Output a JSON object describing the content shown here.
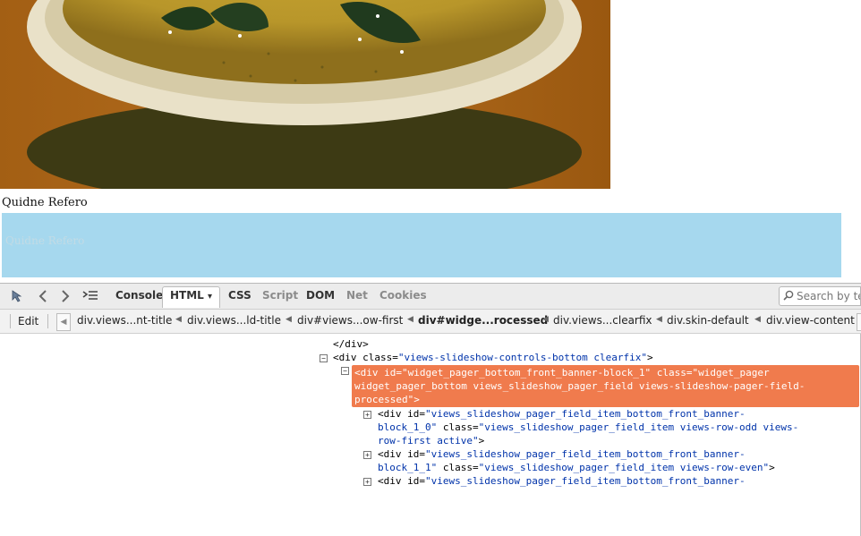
{
  "page": {
    "caption": "Quidne Refero",
    "banner_text": "Quidne Refero"
  },
  "toolbar": {
    "icons": [
      "inspect-icon",
      "back-icon",
      "forward-icon",
      "command-line-icon"
    ],
    "tabs": [
      {
        "label": "Console",
        "state": "normal"
      },
      {
        "label": "HTML",
        "state": "active"
      },
      {
        "label": "CSS",
        "state": "normal"
      },
      {
        "label": "Script",
        "state": "dim"
      },
      {
        "label": "DOM",
        "state": "normal"
      },
      {
        "label": "Net",
        "state": "dim"
      },
      {
        "label": "Cookies",
        "state": "dim"
      }
    ],
    "html_dropdown": "▾",
    "search_placeholder": "Search by te"
  },
  "breadcrumbs": {
    "edit_label": "Edit",
    "items": [
      "div.views...nt-title",
      "div.views...ld-title",
      "div#views...ow-first",
      "div#widge...rocessed",
      "div.views...clearfix",
      "div.skin-default",
      "div.view-content"
    ],
    "selected_index": 3
  },
  "tree": {
    "lines": [
      {
        "id": "l0",
        "text": "</div>"
      },
      {
        "id": "l1",
        "open": "<div ",
        "a1": "class=",
        "v1": "\"views-slideshow-controls-bottom clearfix\"",
        "close": ">"
      },
      {
        "id": "sel1",
        "open": "<div ",
        "a1": "id=",
        "v1": "\"widget_pager_bottom_front_banner-block_1\"",
        "mid": " class=",
        "v2": "\"widget_pager"
      },
      {
        "id": "sel2",
        "text": "widget_pager_bottom views_slideshow_pager_field views-slideshow-pager-field-"
      },
      {
        "id": "sel3",
        "text": "processed\">"
      },
      {
        "id": "r1a",
        "open": "<div ",
        "a1": "id=",
        "v1": "\"views_slideshow_pager_field_item_bottom_front_banner-"
      },
      {
        "id": "r1b",
        "v1": "block_1_0\"",
        "mid": " class=",
        "v2": "\"views_slideshow_pager_field_item views-row-odd views-"
      },
      {
        "id": "r1c",
        "v1": "row-first active\"",
        "close": ">"
      },
      {
        "id": "r2a",
        "open": "<div ",
        "a1": "id=",
        "v1": "\"views_slideshow_pager_field_item_bottom_front_banner-"
      },
      {
        "id": "r2b",
        "v1": "block_1_1\"",
        "mid": " class=",
        "v2": "\"views_slideshow_pager_field_item views-row-even\"",
        "close": ">"
      },
      {
        "id": "r3a",
        "open": "<div ",
        "a1": "id=",
        "v1": "\"views_slideshow_pager_field_item_bottom_front_banner-"
      }
    ],
    "toggle_minus": "−",
    "toggle_plus": "+"
  },
  "colors": {
    "selected_row": "#f07b4d",
    "banner": "#a6d8ee",
    "attr_value": "#0033aa"
  }
}
